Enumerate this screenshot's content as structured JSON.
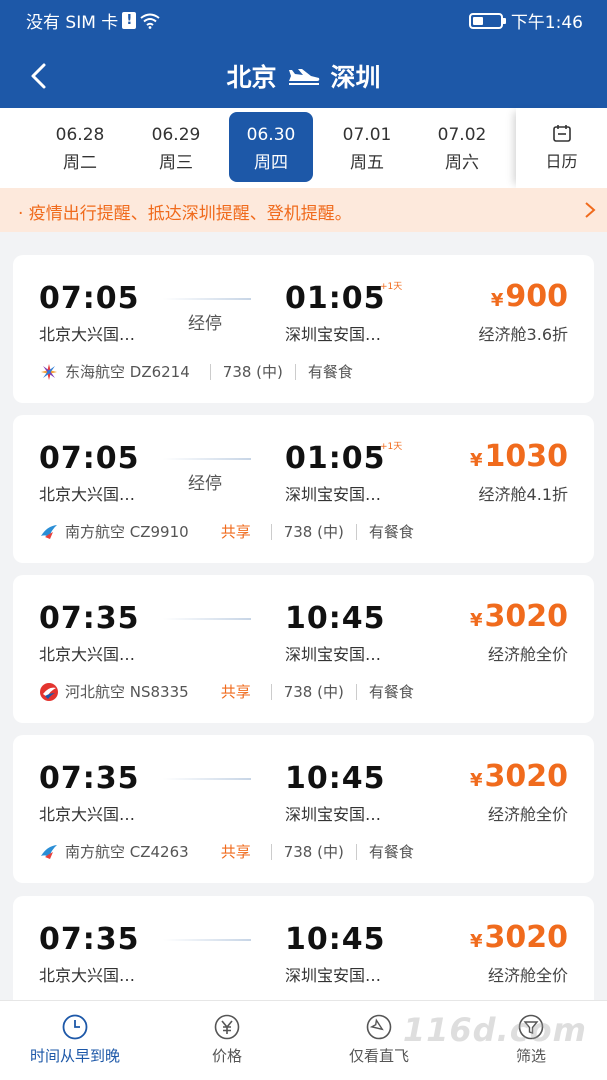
{
  "status_bar": {
    "carrier": "没有 SIM 卡",
    "time": "下午1:46"
  },
  "header": {
    "from": "北京",
    "to": "深圳"
  },
  "dates": [
    {
      "date": "06.28",
      "weekday": "周二",
      "selected": false
    },
    {
      "date": "06.29",
      "weekday": "周三",
      "selected": false
    },
    {
      "date": "06.30",
      "weekday": "周四",
      "selected": true
    },
    {
      "date": "07.01",
      "weekday": "周五",
      "selected": false
    },
    {
      "date": "07.02",
      "weekday": "周六",
      "selected": false
    }
  ],
  "calendar_label": "日历",
  "notice": "· 疫情出行提醒、抵达深圳提醒、登机提醒。",
  "flights": [
    {
      "dep_time": "07:05",
      "dep_airport": "北京大兴国…",
      "stop": "经停",
      "arr_time": "01:05",
      "next_day": "+1天",
      "arr_airport": "深圳宝安国…",
      "currency": "¥",
      "price": "900",
      "cabin": "经济舱3.6折",
      "airline": "东海航空 DZ6214",
      "share": "",
      "aircraft": "738 (中)",
      "meal": "有餐食",
      "logo": "donghai-logo-icon"
    },
    {
      "dep_time": "07:05",
      "dep_airport": "北京大兴国…",
      "stop": "经停",
      "arr_time": "01:05",
      "next_day": "+1天",
      "arr_airport": "深圳宝安国…",
      "currency": "¥",
      "price": "1030",
      "cabin": "经济舱4.1折",
      "airline": "南方航空 CZ9910",
      "share": "共享",
      "aircraft": "738 (中)",
      "meal": "有餐食",
      "logo": "china-southern-logo-icon"
    },
    {
      "dep_time": "07:35",
      "dep_airport": "北京大兴国…",
      "stop": "",
      "arr_time": "10:45",
      "next_day": "",
      "arr_airport": "深圳宝安国…",
      "currency": "¥",
      "price": "3020",
      "cabin": "经济舱全价",
      "airline": "河北航空 NS8335",
      "share": "共享",
      "aircraft": "738 (中)",
      "meal": "有餐食",
      "logo": "hebei-logo-icon"
    },
    {
      "dep_time": "07:35",
      "dep_airport": "北京大兴国…",
      "stop": "",
      "arr_time": "10:45",
      "next_day": "",
      "arr_airport": "深圳宝安国…",
      "currency": "¥",
      "price": "3020",
      "cabin": "经济舱全价",
      "airline": "南方航空 CZ4263",
      "share": "共享",
      "aircraft": "738 (中)",
      "meal": "有餐食",
      "logo": "china-southern-logo-icon"
    },
    {
      "dep_time": "07:35",
      "dep_airport": "北京大兴国…",
      "stop": "",
      "arr_time": "10:45",
      "next_day": "",
      "arr_airport": "深圳宝安国…",
      "currency": "¥",
      "price": "3020",
      "cabin": "经济舱全价"
    }
  ],
  "bottom_tabs": [
    {
      "label": "时间从早到晚",
      "icon": "clock-icon",
      "active": true
    },
    {
      "label": "价格",
      "icon": "yen-icon",
      "active": false
    },
    {
      "label": "仅看直飞",
      "icon": "direct-flight-icon",
      "active": false
    },
    {
      "label": "筛选",
      "icon": "filter-icon",
      "active": false
    }
  ],
  "watermark": "116d.com",
  "colors": {
    "primary": "#1d58a8",
    "accent": "#f06b1d",
    "notice_bg": "#fde9dc"
  }
}
